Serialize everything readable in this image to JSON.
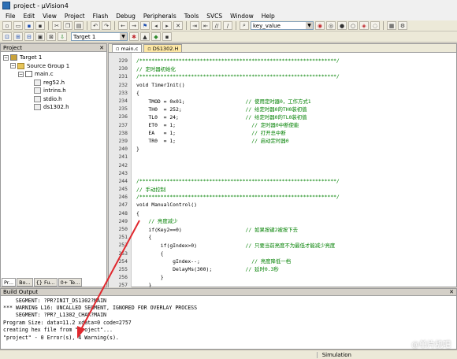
{
  "window": {
    "title": "project - µVision4"
  },
  "menu": [
    "File",
    "Edit",
    "View",
    "Project",
    "Flash",
    "Debug",
    "Peripherals",
    "Tools",
    "SVCS",
    "Window",
    "Help"
  ],
  "toolbar": {
    "find_value": "key_value",
    "target_select": "Target 1"
  },
  "project_panel": {
    "title": "Project",
    "tree": [
      {
        "label": "Target 1",
        "level": 0,
        "icon": "target-icon"
      },
      {
        "label": "Source Group 1",
        "level": 1,
        "icon": "folder-icon"
      },
      {
        "label": "main.c",
        "level": 2,
        "icon": "c-file-icon"
      },
      {
        "label": "reg52.h",
        "level": 3,
        "icon": "header-file-icon"
      },
      {
        "label": "intrins.h",
        "level": 3,
        "icon": "header-file-icon"
      },
      {
        "label": "stdio.h",
        "level": 3,
        "icon": "header-file-icon"
      },
      {
        "label": "ds1302.h",
        "level": 3,
        "icon": "header-file-icon"
      }
    ],
    "tabs": [
      "Pr...",
      "Bo...",
      "{} Fu...",
      "0+ Te..."
    ]
  },
  "editor": {
    "tabs": [
      {
        "label": "main.c",
        "active": true
      },
      {
        "label": "DS1302.H",
        "active": false
      }
    ],
    "lines": [
      {
        "n": "229",
        "text": "/*****************************************************************/",
        "c": true
      },
      {
        "n": "230",
        "text": "// 定时器初始化",
        "c": true
      },
      {
        "n": "231",
        "text": "/*****************************************************************/",
        "c": true
      },
      {
        "n": "232",
        "text": "void TimerInit()",
        "c": false
      },
      {
        "n": "233",
        "text": "{",
        "c": false
      },
      {
        "n": "234",
        "text": "    TMOD = 0x01;                    // 使用定时器0，工作方式1",
        "c": false
      },
      {
        "n": "235",
        "text": "    TH0  = 252;                     // 给定时器0的TH0装初值",
        "c": false
      },
      {
        "n": "236",
        "text": "    TL0  = 24;                      // 给定时器0的TL0装初值",
        "c": false
      },
      {
        "n": "237",
        "text": "    ET0  = 1;                         // 定时器0中断使能",
        "c": false
      },
      {
        "n": "238",
        "text": "    EA   = 1;                         // 打开总中断",
        "c": false
      },
      {
        "n": "239",
        "text": "    TR0  = 1;                         // 启动定时器0",
        "c": false
      },
      {
        "n": "240",
        "text": "}",
        "c": false
      },
      {
        "n": "241",
        "text": "",
        "c": false
      },
      {
        "n": "242",
        "text": "",
        "c": false
      },
      {
        "n": "243",
        "text": "",
        "c": false
      },
      {
        "n": "244",
        "text": "/*****************************************************************/",
        "c": true
      },
      {
        "n": "245",
        "text": "// 手动控制",
        "c": true
      },
      {
        "n": "246",
        "text": "/*****************************************************************/",
        "c": true
      },
      {
        "n": "247",
        "text": "void ManualControl()",
        "c": false
      },
      {
        "n": "248",
        "text": "{",
        "c": false
      },
      {
        "n": "249",
        "text": "    // 亮度减少",
        "c": true
      },
      {
        "n": "250",
        "text": "    if(Key2==0)                     // 如果按键2被按下去",
        "c": false
      },
      {
        "n": "251",
        "text": "    {",
        "c": false
      },
      {
        "n": "252",
        "text": "        if(gIndex>0)                // 只要当前亮度不为最低才能减少亮度",
        "c": false
      },
      {
        "n": "253",
        "text": "        {",
        "c": false
      },
      {
        "n": "254",
        "text": "            gIndex--;                 // 亮度降低一档",
        "c": false
      },
      {
        "n": "255",
        "text": "            DelayMs(300);           // 延时0.3秒",
        "c": false
      },
      {
        "n": "256",
        "text": "        }",
        "c": false
      },
      {
        "n": "257",
        "text": "    }",
        "c": false
      },
      {
        "n": "258",
        "text": "",
        "c": false
      },
      {
        "n": "259",
        "text": "    // 亮度增加",
        "c": true
      },
      {
        "n": "260",
        "text": "    if(Key3==0)                     // 如果按键3被按下去",
        "c": false
      },
      {
        "n": "261",
        "text": "    {",
        "c": false
      }
    ]
  },
  "build_output": {
    "title": "Build Output",
    "lines": [
      "    SEGMENT: ?PR?INIT_DS1302?MAIN",
      "*** WARNING L16: UNCALLED SEGMENT, IGNORED FOR OVERLAY PROCESS",
      "    SEGMENT: ?PR?_L1302_CHAR?MAIN",
      "Program Size: data=11.2 xdata=0 code=2757",
      "creating hex file from \"project\"...",
      "\"project\" - 0 Error(s), 4 Warning(s)."
    ]
  },
  "status": {
    "mode": "Simulation"
  },
  "watermark": "@单片机吧",
  "colors": {
    "annotation_arrow": "#e0282e",
    "comment": "#008000"
  }
}
